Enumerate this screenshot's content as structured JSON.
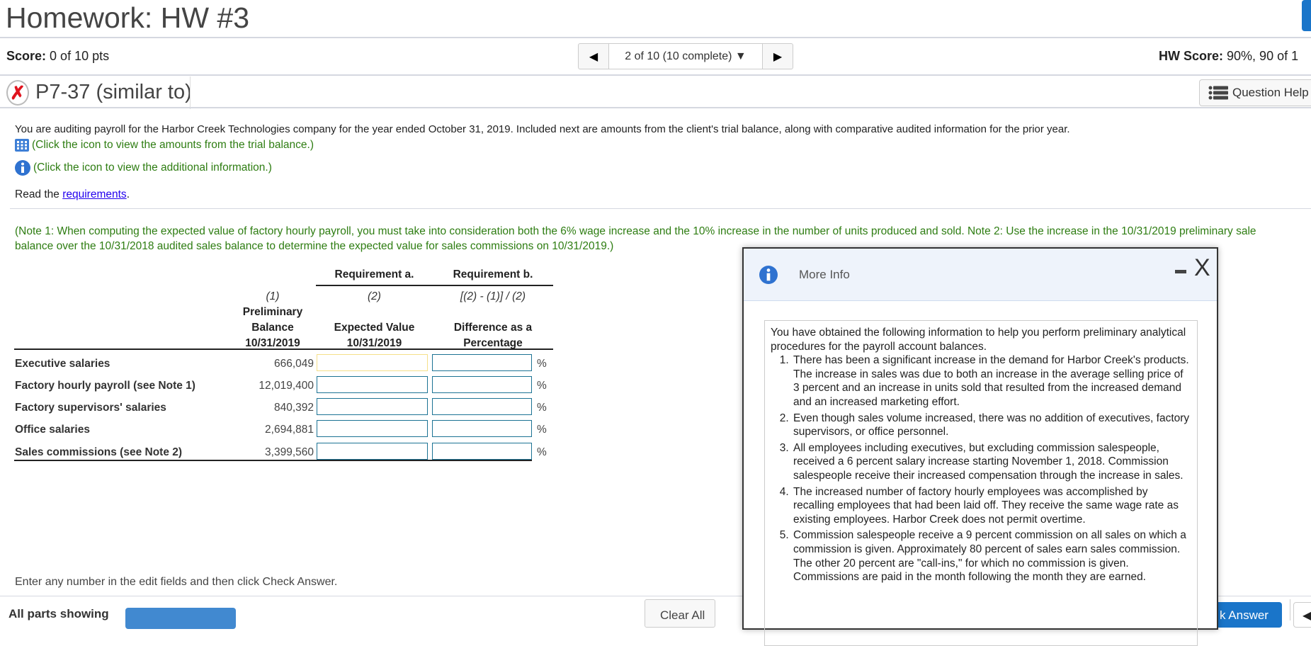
{
  "header": {
    "title": "Homework: HW #3"
  },
  "scorebar": {
    "score_label": "Score:",
    "score_value": "0 of 10 pts",
    "nav_text": "2 of 10 (10 complete)",
    "hw_score_label": "HW Score:",
    "hw_score_value": "90%, 90 of 1"
  },
  "question": {
    "name": "P7-37 (similar to)",
    "status": "incorrect",
    "help_label": "Question Help"
  },
  "body": {
    "intro": "You are auditing payroll for the Harbor Creek Technologies company for the year ended October 31, 2019. Included next are amounts from the client's trial balance, along with comparative audited information for the prior year.",
    "trial_link": "(Click the icon to view the amounts from the trial balance.)",
    "info_link": "(Click the icon to view the additional information.)",
    "read_prefix": "Read the ",
    "read_link": "requirements",
    "read_suffix": ".",
    "note_line1": "(Note 1: When computing the expected value of factory hourly payroll, you must take into consideration both the 6% wage increase and the 10% increase in the number of units produced and sold. Note 2: Use the increase in the 10/31/2019 preliminary sale",
    "note_line2": "balance over the 10/31/2018 audited sales balance to determine the expected value for sales commissions on 10/31/2019.)"
  },
  "table": {
    "req_a": "Requirement a.",
    "req_b": "Requirement b.",
    "col1_num": "(1)",
    "col2_num": "(2)",
    "col3_formula": "[(2) - (1)] / (2)",
    "col1_head": [
      "Preliminary",
      "Balance",
      "10/31/2019"
    ],
    "col2_head": [
      "Expected Value",
      "10/31/2019"
    ],
    "col3_head": [
      "Difference as a",
      "Percentage"
    ],
    "pct": "%",
    "rows": [
      {
        "label": "Executive salaries",
        "value": "666,049",
        "expected": "",
        "difference": ""
      },
      {
        "label": "Factory hourly payroll (see Note 1)",
        "value": "12,019,400",
        "expected": "",
        "difference": ""
      },
      {
        "label": "Factory supervisors' salaries",
        "value": "840,392",
        "expected": "",
        "difference": ""
      },
      {
        "label": "Office salaries",
        "value": "2,694,881",
        "expected": "",
        "difference": ""
      },
      {
        "label": "Sales commissions (see Note 2)",
        "value": "3,399,560",
        "expected": "",
        "difference": ""
      }
    ]
  },
  "footer": {
    "instruction": "Enter any number in the edit fields and then click Check Answer.",
    "all_parts": "All parts showing",
    "clear_all": "Clear All",
    "check_answer": "k Answer"
  },
  "dialog": {
    "title": "More Info",
    "minimize": "-",
    "close": "X",
    "intro": "You have obtained the following information to help you perform preliminary analytical procedures for the payroll account balances.",
    "items": [
      "There has been a significant increase in the demand for Harbor Creek's products. The increase in sales was due to both an increase in the average selling price of 3 percent and an increase in units sold that resulted from the increased demand and an increased marketing effort.",
      "Even though sales volume increased, there was no addition of executives, factory supervisors, or office personnel.",
      "All employees including executives, but excluding commission salespeople, received a 6 percent salary increase starting November 1, 2018. Commission salespeople receive their increased compensation through the increase in sales.",
      "The increased number of factory hourly employees was accomplished by recalling employees that had been laid off. They receive the same wage rate as existing employees. Harbor Creek does not permit overtime.",
      "Commission salespeople receive a 9 percent commission on all sales on which a commission is given. Approximately 80 percent of sales earn sales commission. The other 20 percent are \"call-ins,\" for which no commission is given. Commissions are paid in the month following the month they are earned."
    ]
  },
  "colors": {
    "accent": "#1a75c9",
    "green_text": "#2e7d12",
    "link": "#2200ee",
    "input_border": "#1c7394",
    "focus_input_border": "#f5e08a",
    "error": "#e0141e"
  }
}
